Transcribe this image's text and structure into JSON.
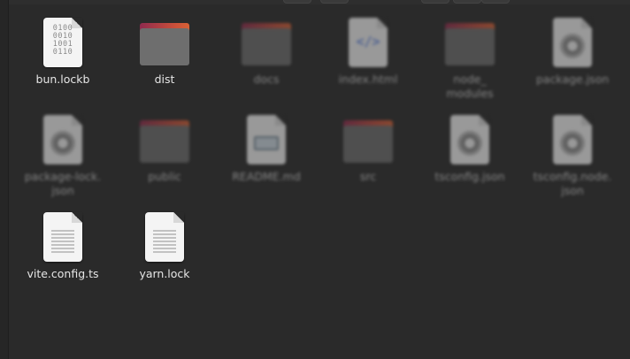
{
  "files": [
    {
      "label": "bun.lockb",
      "icon": "binary-file-icon",
      "dim": false
    },
    {
      "label": "dist",
      "icon": "folder-icon",
      "dim": false
    },
    {
      "label": "docs",
      "icon": "folder-icon",
      "dim": true
    },
    {
      "label": "index.html",
      "icon": "html-file-icon",
      "dim": true
    },
    {
      "label": "node_\nmodules",
      "icon": "folder-icon",
      "dim": true
    },
    {
      "label": "package.json",
      "icon": "json-file-icon",
      "dim": true
    },
    {
      "label": "package-lock.\njson",
      "icon": "json-file-icon",
      "dim": true
    },
    {
      "label": "public",
      "icon": "folder-icon",
      "dim": true
    },
    {
      "label": "README.md",
      "icon": "markdown-file-icon",
      "dim": true
    },
    {
      "label": "src",
      "icon": "folder-icon",
      "dim": true
    },
    {
      "label": "tsconfig.json",
      "icon": "json-file-icon",
      "dim": true
    },
    {
      "label": "tsconfig.node.\njson",
      "icon": "json-file-icon",
      "dim": true
    },
    {
      "label": "vite.config.ts",
      "icon": "text-file-icon",
      "dim": false
    },
    {
      "label": "yarn.lock",
      "icon": "text-file-icon",
      "dim": false
    }
  ],
  "colors": {
    "background": "#2a2a2a",
    "folder_tab": "#c94f3a",
    "folder_body": "#6e6e6e",
    "label": "#e6e6e6"
  }
}
